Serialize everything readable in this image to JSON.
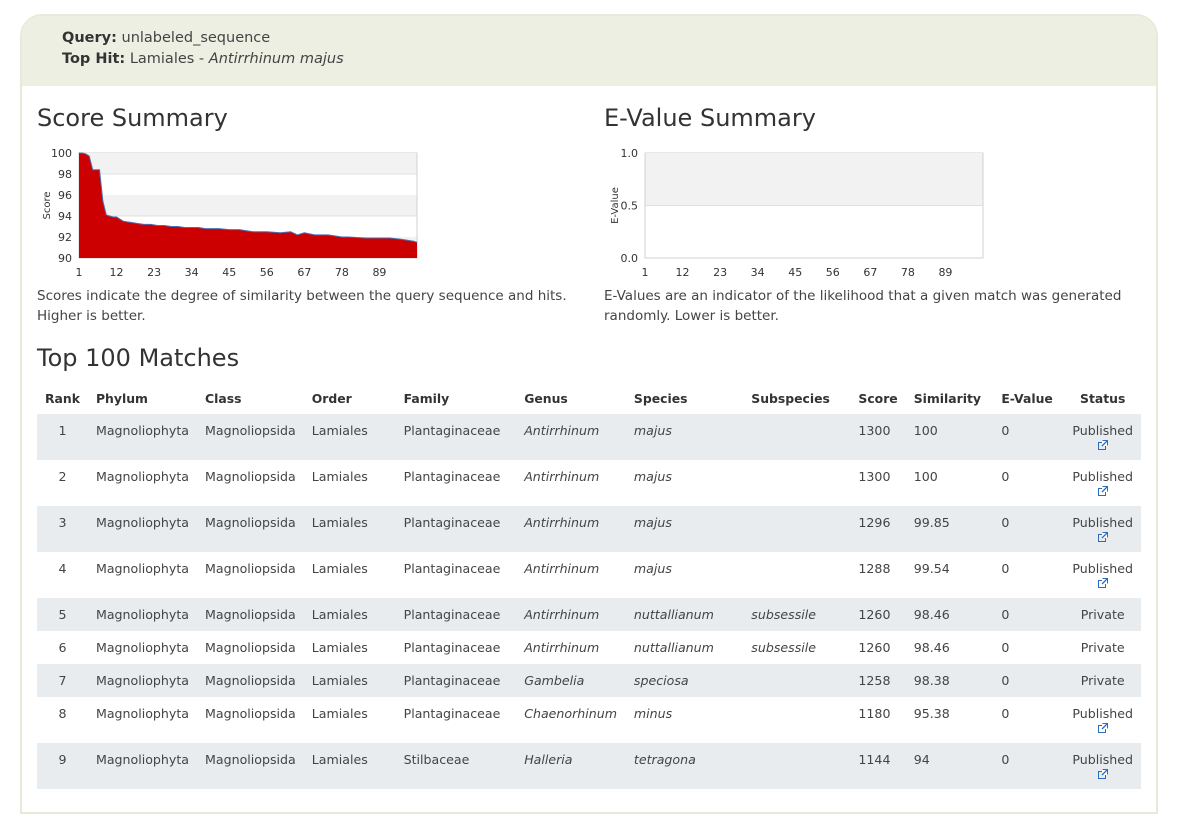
{
  "header": {
    "query_label": "Query:",
    "query_value": "unlabeled_sequence",
    "tophit_label": "Top Hit:",
    "tophit_order": "Lamiales",
    "tophit_sep": " - ",
    "tophit_species": "Antirrhinum majus"
  },
  "score_summary": {
    "title": "Score Summary",
    "description": "Scores indicate the degree of similarity between the query sequence and hits. Higher is better."
  },
  "evalue_summary": {
    "title": "E-Value Summary",
    "description": "E-Values are an indicator of the likelihood that a given match was generated randomly. Lower is better."
  },
  "chart_data": [
    {
      "type": "area",
      "ylabel": "Score",
      "ylim": [
        90,
        100
      ],
      "yticks": [
        "100",
        "98",
        "96",
        "94",
        "92",
        "90"
      ],
      "xticks": [
        "1",
        "12",
        "23",
        "34",
        "45",
        "56",
        "67",
        "78",
        "89"
      ],
      "grid": "horizontal bands",
      "color": "#cc0000",
      "line_color": "#4a6fb5",
      "series": [
        {
          "x": [
            1,
            2,
            3,
            4,
            5,
            6,
            7,
            8,
            9,
            10,
            11,
            12,
            14,
            16,
            18,
            20,
            22,
            24,
            26,
            28,
            30,
            32,
            34,
            36,
            38,
            40,
            42,
            45,
            48,
            50,
            52,
            56,
            60,
            63,
            65,
            67,
            70,
            74,
            78,
            80,
            85,
            89,
            92,
            95,
            97,
            99,
            100
          ],
          "values": [
            100,
            100,
            99.9,
            99.7,
            98.4,
            98.4,
            98.4,
            95.4,
            94.1,
            94.0,
            93.9,
            93.9,
            93.5,
            93.4,
            93.3,
            93.2,
            93.2,
            93.1,
            93.1,
            93.0,
            93.0,
            92.9,
            92.9,
            92.9,
            92.8,
            92.8,
            92.8,
            92.7,
            92.7,
            92.6,
            92.5,
            92.5,
            92.4,
            92.5,
            92.2,
            92.4,
            92.2,
            92.2,
            92.0,
            92.0,
            91.9,
            91.9,
            91.9,
            91.8,
            91.7,
            91.6,
            91.5
          ]
        }
      ]
    },
    {
      "type": "area",
      "ylabel": "E-Value",
      "ylim": [
        0,
        1
      ],
      "yticks": [
        "1.0",
        "0.5",
        "0.0"
      ],
      "xticks": [
        "1",
        "12",
        "23",
        "34",
        "45",
        "56",
        "67",
        "78",
        "89"
      ],
      "grid": "horizontal bands",
      "series": [
        {
          "x": [
            1,
            100
          ],
          "values": [
            0,
            0
          ]
        }
      ]
    }
  ],
  "matches": {
    "title": "Top 100 Matches",
    "columns": [
      "Rank",
      "Phylum",
      "Class",
      "Order",
      "Family",
      "Genus",
      "Species",
      "Subspecies",
      "Score",
      "Similarity",
      "E-Value",
      "Status"
    ],
    "rows": [
      {
        "rank": "1",
        "phylum": "Magnoliophyta",
        "class": "Magnoliopsida",
        "order": "Lamiales",
        "family": "Plantaginaceae",
        "genus": "Antirrhinum",
        "species": "majus",
        "subspecies": "",
        "score": "1300",
        "similarity": "100",
        "evalue": "0",
        "status": "Published",
        "link": true
      },
      {
        "rank": "2",
        "phylum": "Magnoliophyta",
        "class": "Magnoliopsida",
        "order": "Lamiales",
        "family": "Plantaginaceae",
        "genus": "Antirrhinum",
        "species": "majus",
        "subspecies": "",
        "score": "1300",
        "similarity": "100",
        "evalue": "0",
        "status": "Published",
        "link": true
      },
      {
        "rank": "3",
        "phylum": "Magnoliophyta",
        "class": "Magnoliopsida",
        "order": "Lamiales",
        "family": "Plantaginaceae",
        "genus": "Antirrhinum",
        "species": "majus",
        "subspecies": "",
        "score": "1296",
        "similarity": "99.85",
        "evalue": "0",
        "status": "Published",
        "link": true
      },
      {
        "rank": "4",
        "phylum": "Magnoliophyta",
        "class": "Magnoliopsida",
        "order": "Lamiales",
        "family": "Plantaginaceae",
        "genus": "Antirrhinum",
        "species": "majus",
        "subspecies": "",
        "score": "1288",
        "similarity": "99.54",
        "evalue": "0",
        "status": "Published",
        "link": true
      },
      {
        "rank": "5",
        "phylum": "Magnoliophyta",
        "class": "Magnoliopsida",
        "order": "Lamiales",
        "family": "Plantaginaceae",
        "genus": "Antirrhinum",
        "species": "nuttallianum",
        "subspecies": "subsessile",
        "score": "1260",
        "similarity": "98.46",
        "evalue": "0",
        "status": "Private",
        "link": false
      },
      {
        "rank": "6",
        "phylum": "Magnoliophyta",
        "class": "Magnoliopsida",
        "order": "Lamiales",
        "family": "Plantaginaceae",
        "genus": "Antirrhinum",
        "species": "nuttallianum",
        "subspecies": "subsessile",
        "score": "1260",
        "similarity": "98.46",
        "evalue": "0",
        "status": "Private",
        "link": false
      },
      {
        "rank": "7",
        "phylum": "Magnoliophyta",
        "class": "Magnoliopsida",
        "order": "Lamiales",
        "family": "Plantaginaceae",
        "genus": "Gambelia",
        "species": "speciosa",
        "subspecies": "",
        "score": "1258",
        "similarity": "98.38",
        "evalue": "0",
        "status": "Private",
        "link": false
      },
      {
        "rank": "8",
        "phylum": "Magnoliophyta",
        "class": "Magnoliopsida",
        "order": "Lamiales",
        "family": "Plantaginaceae",
        "genus": "Chaenorhinum",
        "species": "minus",
        "subspecies": "",
        "score": "1180",
        "similarity": "95.38",
        "evalue": "0",
        "status": "Published",
        "link": true
      },
      {
        "rank": "9",
        "phylum": "Magnoliophyta",
        "class": "Magnoliopsida",
        "order": "Lamiales",
        "family": "Stilbaceae",
        "genus": "Halleria",
        "species": "tetragona",
        "subspecies": "",
        "score": "1144",
        "similarity": "94",
        "evalue": "0",
        "status": "Published",
        "link": true
      }
    ]
  },
  "colors": {
    "header_bg": "#eeefe3",
    "row_shade": "#e9ecef",
    "area_fill": "#cc0000",
    "link_icon": "#2a6ebb"
  },
  "icons": {
    "external_link": "external-link-icon"
  }
}
